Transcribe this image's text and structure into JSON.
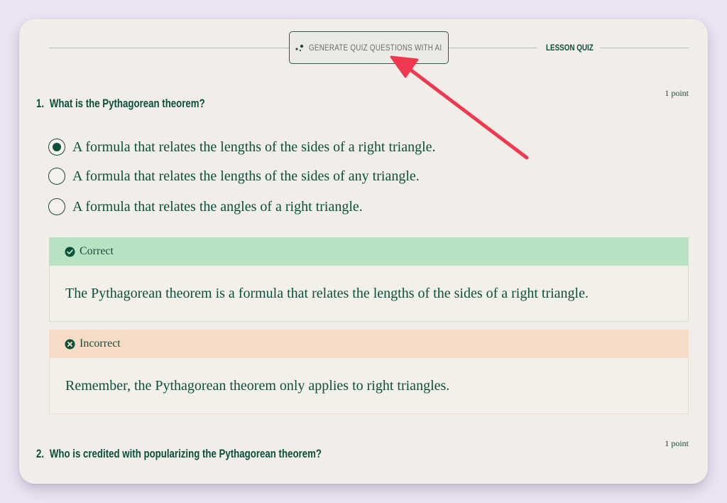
{
  "header": {
    "generate_button_label": "GENERATE QUIZ QUESTIONS WITH AI",
    "section_label": "LESSON QUIZ"
  },
  "questions": [
    {
      "number": "1.",
      "title": "What is the Pythagorean theorem?",
      "points": "1 point",
      "options": [
        {
          "label": "A formula that relates the lengths of the sides of a right triangle.",
          "selected": true
        },
        {
          "label": "A formula that relates the lengths of the sides of any triangle.",
          "selected": false
        },
        {
          "label": "A formula that relates the angles of a right triangle.",
          "selected": false
        }
      ],
      "feedback": {
        "correct": {
          "label": "Correct",
          "text": "The Pythagorean theorem is a formula that relates the lengths of the sides of a right triangle."
        },
        "incorrect": {
          "label": "Incorrect",
          "text": "Remember, the Pythagorean theorem only applies to right triangles."
        }
      }
    },
    {
      "number": "2.",
      "title": "Who is credited with popularizing the Pythagorean theorem?",
      "points": "1 point"
    }
  ],
  "colors": {
    "primary": "#0b4f3d",
    "correct_bg": "#b8e3c2",
    "incorrect_bg": "#f6dcc6",
    "card_bg": "#f1ede8",
    "page_bg": "#ebe4f3",
    "annotation_arrow": "#f0384f"
  },
  "icons": {
    "generate": "sparkle-icon",
    "correct": "check-circle-icon",
    "incorrect": "x-circle-icon"
  }
}
